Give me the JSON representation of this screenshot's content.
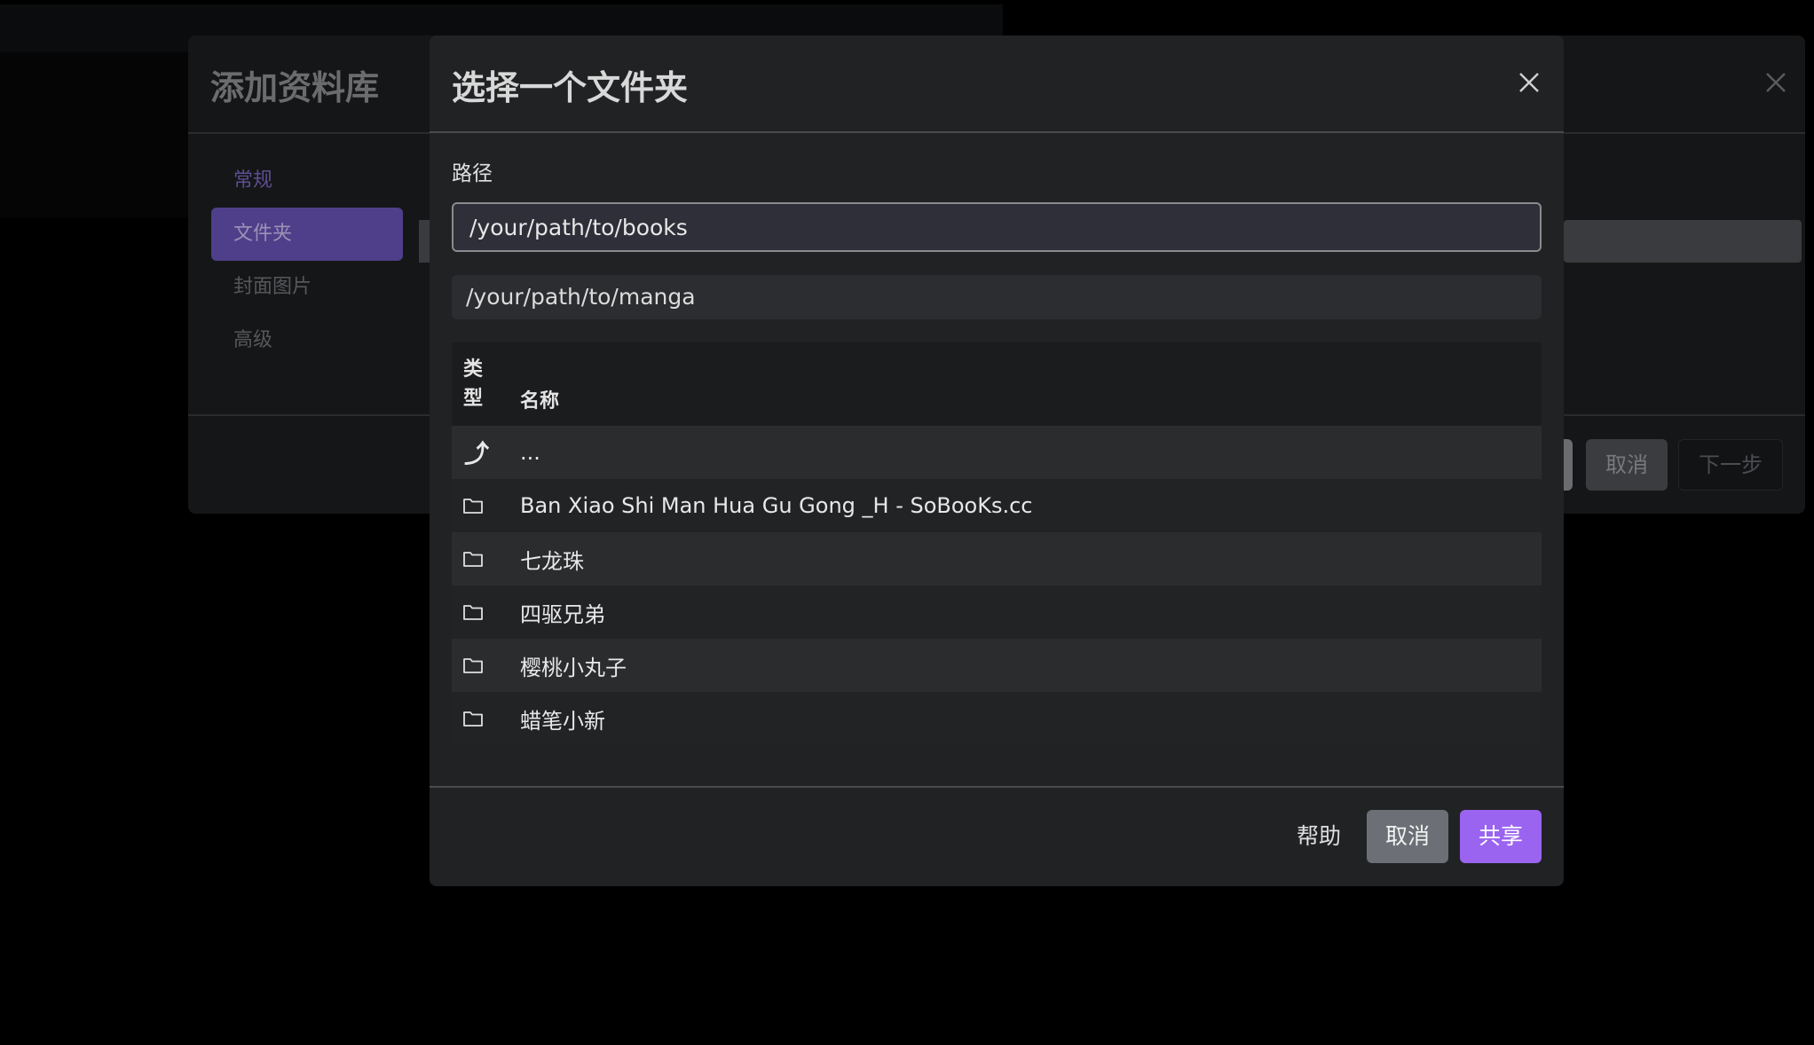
{
  "background_dialog": {
    "title": "添加资料库",
    "nav_items": [
      {
        "label": "常规",
        "state": "link"
      },
      {
        "label": "文件夹",
        "state": "active"
      },
      {
        "label": "封面图片",
        "state": "normal"
      },
      {
        "label": "高级",
        "state": "normal"
      }
    ],
    "cancel_label": "取消",
    "next_label": "下一步"
  },
  "modal": {
    "title": "选择一个文件夹",
    "path_label": "路径",
    "path_value": "/your/path/to/books",
    "suggestion": "/your/path/to/manga",
    "table": {
      "header_type": "类型",
      "header_type_line1": "类",
      "header_type_line2": "型",
      "header_name": "名称",
      "parent_row": {
        "icon": "up-arrow-icon",
        "name": "..."
      },
      "rows": [
        {
          "icon": "folder-icon",
          "name": "Ban Xiao Shi Man Hua Gu Gong _H - SoBooKs.cc"
        },
        {
          "icon": "folder-icon",
          "name": "七龙珠"
        },
        {
          "icon": "folder-icon",
          "name": "四驱兄弟"
        },
        {
          "icon": "folder-icon",
          "name": "樱桃小丸子"
        },
        {
          "icon": "folder-icon",
          "name": "蜡笔小新"
        }
      ]
    },
    "help_label": "帮助",
    "cancel_label": "取消",
    "share_label": "共享"
  },
  "colors": {
    "accent": "#9a64f0",
    "active_nav": "#4f3f8a",
    "modal_bg": "#212224"
  }
}
